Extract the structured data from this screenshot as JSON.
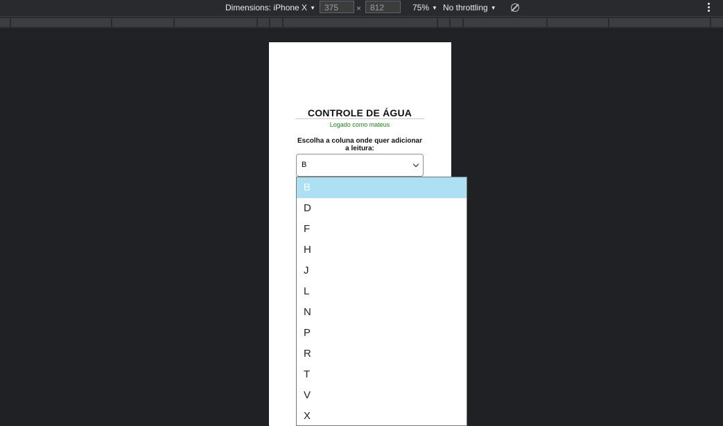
{
  "devtools": {
    "dimensions_label": "Dimensions: iPhone X",
    "width_value": "375",
    "times_sign": "×",
    "height_value": "812",
    "zoom_label": "75%",
    "throttling_label": "No throttling"
  },
  "page": {
    "title": "CONTROLE DE ÁGUA",
    "logged_as": "Logado como mateus",
    "column_prompt": "Escolha a coluna onde quer adicionar a leitura:",
    "select_value": "B"
  },
  "dropdown": {
    "options": [
      "B",
      "D",
      "F",
      "H",
      "J",
      "L",
      "N",
      "P",
      "R",
      "T",
      "V",
      "X"
    ],
    "selected": "B"
  }
}
